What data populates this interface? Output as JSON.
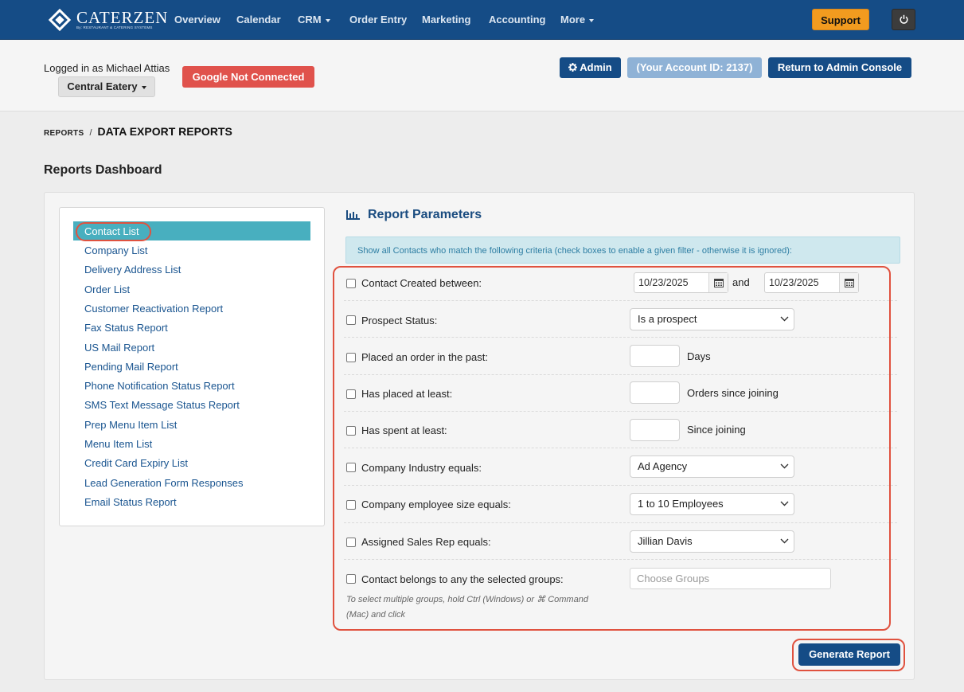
{
  "nav": {
    "logo_name": "CATERZEN",
    "logo_tagline": "By: RESTAURANT & CATERING SYSTEMS",
    "items": [
      "Overview",
      "Calendar",
      "CRM",
      "Order Entry",
      "Marketing",
      "Accounting",
      "More"
    ],
    "support_label": "Support"
  },
  "header": {
    "logged_in_text": "Logged in as Michael Attias",
    "location": "Central Eatery",
    "google_status": "Google Not Connected",
    "admin_label": "Admin",
    "account_id_label": "(Your Account ID: 2137)",
    "return_label": "Return to Admin Console"
  },
  "breadcrumb": {
    "parent": "REPORTS",
    "separator": "/",
    "current": "DATA EXPORT REPORTS"
  },
  "page_title": "Reports Dashboard",
  "sidebar": {
    "items": [
      "Contact List",
      "Company List",
      "Delivery Address List",
      "Order List",
      "Customer Reactivation Report",
      "Fax Status Report",
      "US Mail Report",
      "Pending Mail Report",
      "Phone Notification Status Report",
      "SMS Text Message Status Report",
      "Prep Menu Item List",
      "Menu Item List",
      "Credit Card Expiry List",
      "Lead Generation Form Responses",
      "Email Status Report"
    ],
    "active_index": 0
  },
  "params": {
    "title": "Report Parameters",
    "info": "Show all Contacts who match the following criteria (check boxes to enable a given filter - otherwise it is ignored):",
    "rows": [
      {
        "label": "Contact Created between:",
        "date_from": "10/23/2025",
        "and_label": "and",
        "date_to": "10/23/2025"
      },
      {
        "label": "Prospect Status:",
        "value": "Is a prospect"
      },
      {
        "label": "Placed an order in the past:",
        "unit": "Days"
      },
      {
        "label": "Has placed at least:",
        "unit": "Orders since joining"
      },
      {
        "label": "Has spent at least:",
        "unit": "Since joining"
      },
      {
        "label": "Company Industry equals:",
        "value": "Ad Agency"
      },
      {
        "label": "Company employee size equals:",
        "value": "1 to 10 Employees"
      },
      {
        "label": "Assigned Sales Rep equals:",
        "value": "Jillian Davis"
      },
      {
        "label": "Contact belongs to any the selected groups:",
        "placeholder": "Choose Groups"
      }
    ],
    "hint": "To select multiple groups, hold Ctrl (Windows) or ⌘ Command (Mac) and click",
    "generate_label": "Generate Report"
  },
  "colors": {
    "nav_bg": "#154c86",
    "support": "#f29b1f",
    "google_error": "#e0524c",
    "active_item": "#48afbf",
    "annotation_red": "#e0523f"
  }
}
